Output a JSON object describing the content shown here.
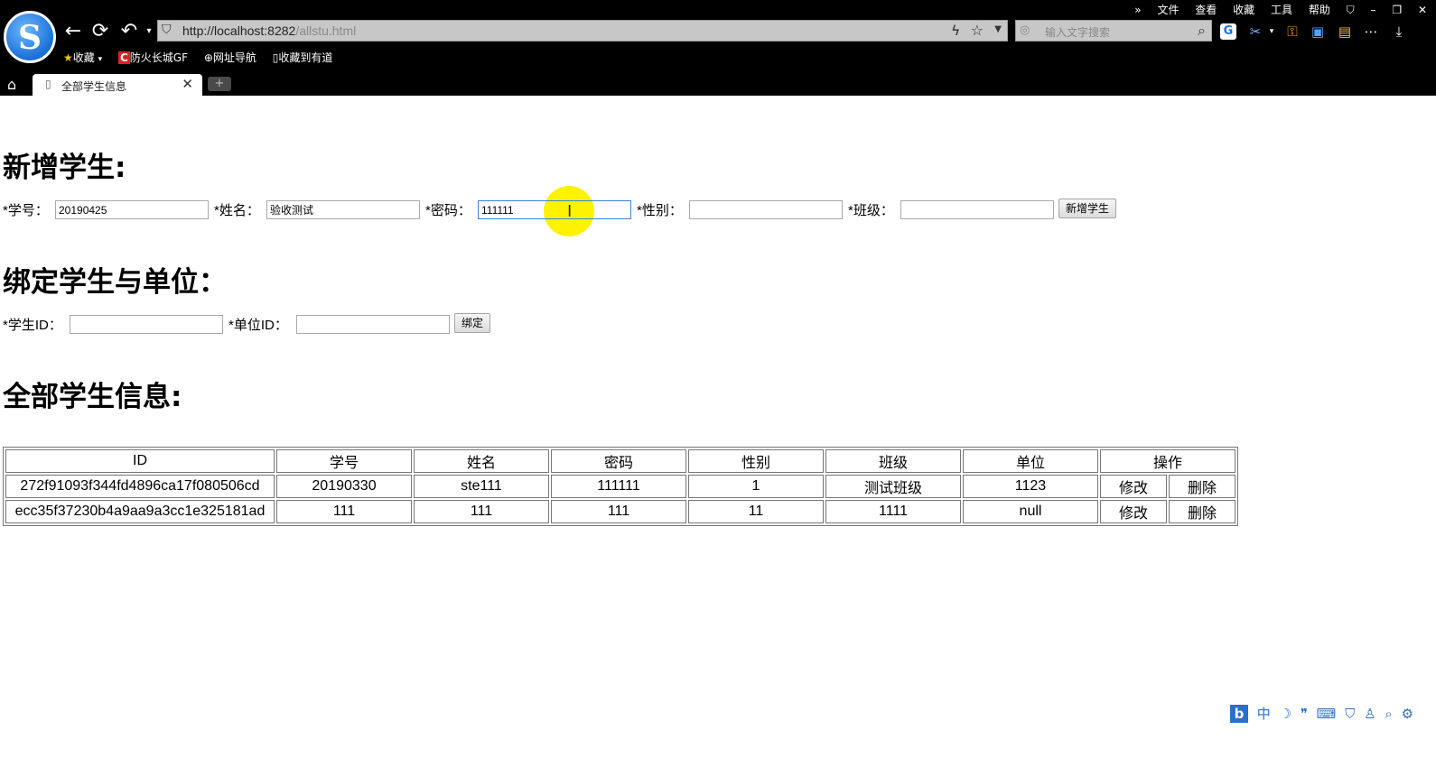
{
  "browser": {
    "menubar": [
      "»",
      "文件",
      "查看",
      "收藏",
      "工具",
      "帮助"
    ],
    "address": {
      "host": "http://localhost:8282",
      "path": "/allstu.html"
    },
    "search_placeholder": "输入文字搜索",
    "bookmarks": [
      "收藏",
      "防火长城GF",
      "网址导航",
      "收藏到有道"
    ],
    "tab_title": "全部学生信息"
  },
  "add_student": {
    "heading": "新增学生:",
    "fields": [
      {
        "label": "*学号：",
        "value": "20190425"
      },
      {
        "label": "*姓名：",
        "value": "验收测试"
      },
      {
        "label": "*密码：",
        "value": "111111"
      },
      {
        "label": "*性别：",
        "value": ""
      },
      {
        "label": "*班级：",
        "value": ""
      }
    ],
    "submit_label": "新增学生"
  },
  "bind": {
    "heading": "绑定学生与单位：",
    "student_id_label": "*学生ID：",
    "unit_id_label": "*单位ID：",
    "button_label": "绑定"
  },
  "students": {
    "heading": "全部学生信息:",
    "columns": [
      "ID",
      "学号",
      "姓名",
      "密码",
      "性别",
      "班级",
      "单位",
      "操作"
    ],
    "rows": [
      {
        "id": "272f91093f344fd4896ca17f080506cd",
        "sno": "20190330",
        "name": "ste111",
        "pwd": "111111",
        "gender": "1",
        "cls": "测试班级",
        "unit": "1123"
      },
      {
        "id": "ecc35f37230b4a9aa9a3cc1e325181ad",
        "sno": "111",
        "name": "111",
        "pwd": "111",
        "gender": "11",
        "cls": "1111",
        "unit": "null"
      }
    ],
    "edit_label": "修改",
    "delete_label": "删除"
  },
  "ime": {
    "mode": "中"
  }
}
